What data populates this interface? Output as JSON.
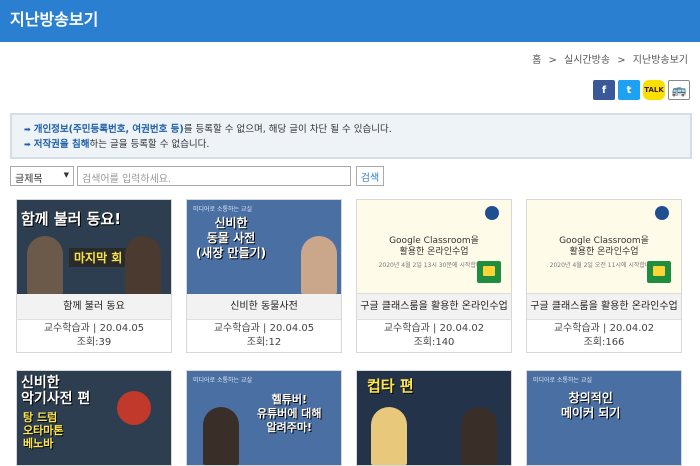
{
  "page": {
    "title": "지난방송보기"
  },
  "breadcrumb": {
    "home": "홈",
    "sep": ">",
    "parent": "실시간방송",
    "current": "지난방송보기"
  },
  "social": {
    "facebook": "f",
    "twitter": "t",
    "talk": "TALK",
    "bus": "🚌"
  },
  "notice": {
    "line1_pre": "개인정보(주민등록번호, 여권번호 등)",
    "line1_post": "를 등록할 수 없으며, 해당 글이 차단 될 수 있습니다.",
    "line2_pre": "저작권을 침해",
    "line2_post": "하는 글을 등록할 수 없습니다."
  },
  "search": {
    "field_selected": "글제목",
    "placeholder": "검색어를 입력하세요.",
    "button": "검색"
  },
  "cards": [
    {
      "title": "함께 불러 동요",
      "meta1": "교수학습과 | 20.04.05",
      "meta2": "조회:39",
      "thumb_text": "함께 불러 동요!",
      "thumb_badge": "마지막 회"
    },
    {
      "title": "신비한 동물사전",
      "meta1": "교수학습과 | 20.04.05",
      "meta2": "조회:12",
      "thumb_tag": "미디어로 소통하는 교실",
      "thumb_text": "신비한\n동물 사전\n(새장 만들기)"
    },
    {
      "title": "구글 클래스룸을 활용한 온라인수업",
      "meta1": "교수학습과 | 20.04.02",
      "meta2": "조회:140",
      "thumb_text": "Google Classroom을\n활용한 온라인수업",
      "thumb_sub": "2020년 4월 2일 13시 30분에 시작합니다!"
    },
    {
      "title": "구글 클래스룸을 활용한 온라인수업",
      "meta1": "교수학습과 | 20.04.02",
      "meta2": "조회:166",
      "thumb_text": "Google Classroom을\n활용한 온라인수업",
      "thumb_sub": "2020년 4월 2일 오전 11시에 시작합니다!"
    },
    {
      "thumb_text": "신비한\n악기사전 편",
      "thumb_sub": "탕 드럼\n오타마톤\n베노바"
    },
    {
      "thumb_tag": "미디어로 소통하는 교실",
      "thumb_text": "헬튜버!\n유튜버에 대해\n알려주마!"
    },
    {
      "thumb_text": "컵타 편"
    },
    {
      "thumb_tag": "미디어로 소통하는 교실",
      "thumb_text": "창의적인\n메이커 되기"
    }
  ],
  "colors": {
    "header": "#2b7fd0",
    "facebook": "#3b5998",
    "twitter": "#1da1f2",
    "talk": "#f9e000",
    "bus": "#555555"
  }
}
